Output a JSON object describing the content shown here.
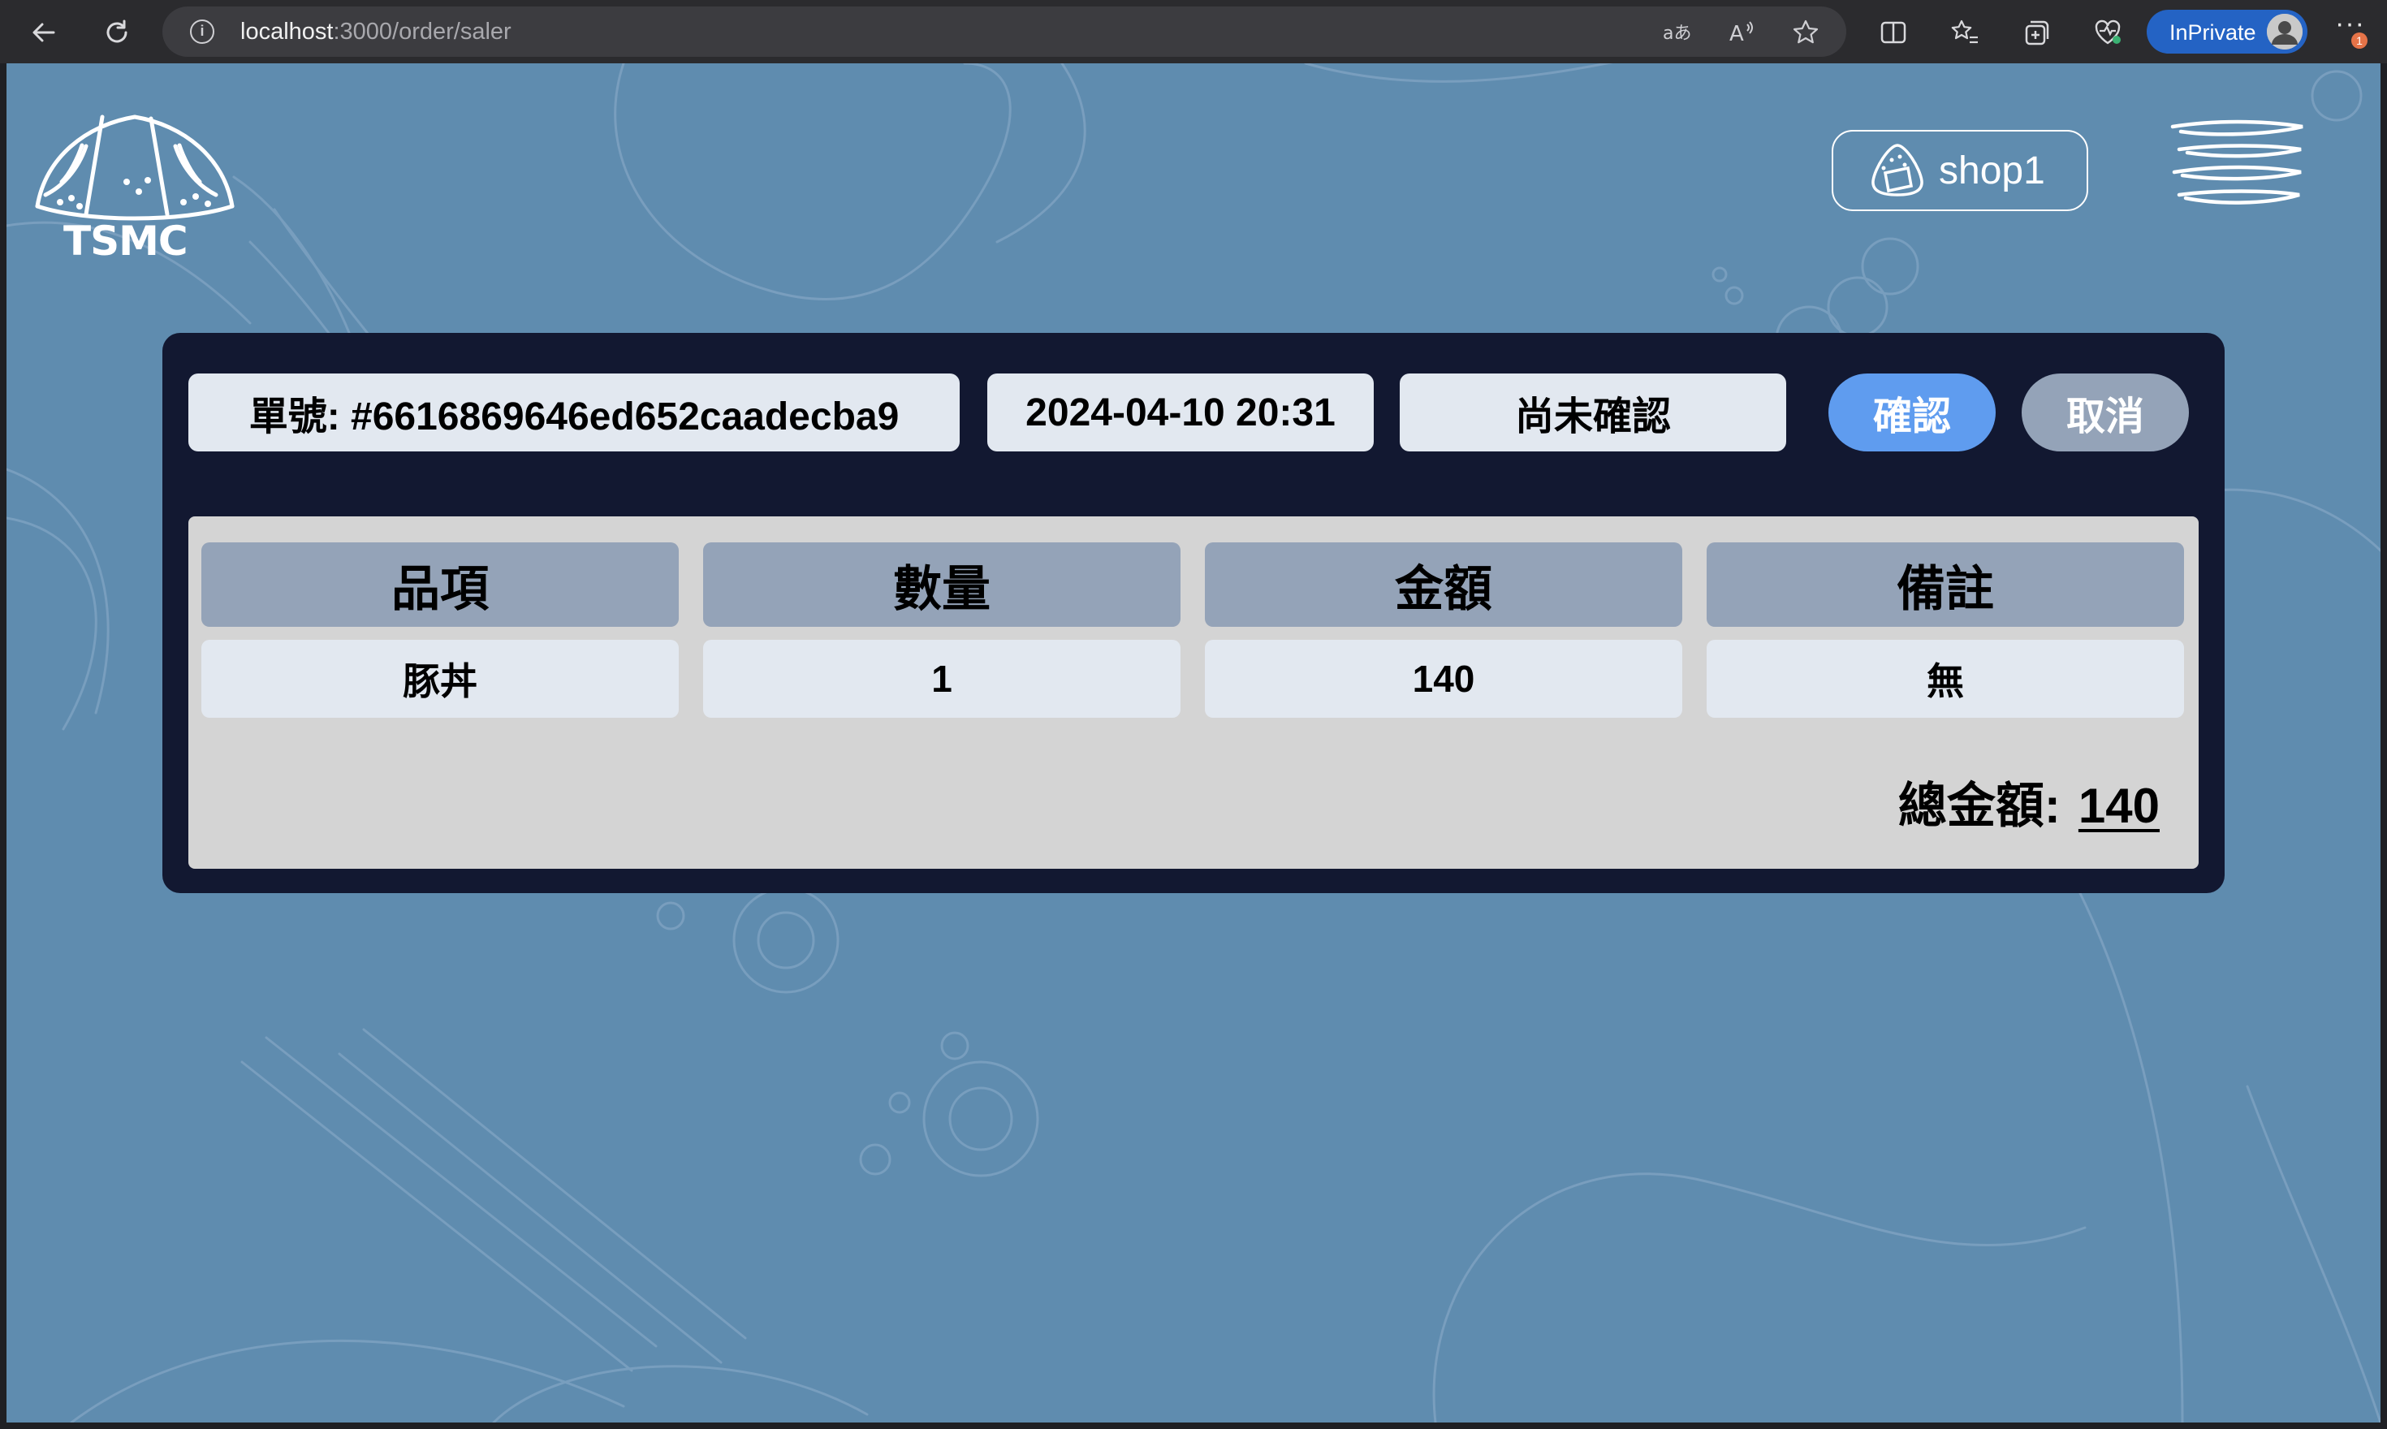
{
  "browser": {
    "url_host": "localhost",
    "url_path": ":3000/order/saler",
    "inprivate_label": "InPrivate",
    "notification_count": "1"
  },
  "header": {
    "brand": "TSMC",
    "shop_label": "shop1"
  },
  "order": {
    "id_label": "單號: #6616869646ed652caadecba9",
    "datetime": "2024-04-10 20:31",
    "status": "尚未確認",
    "confirm_label": "確認",
    "cancel_label": "取消"
  },
  "table": {
    "headers": [
      "品項",
      "數量",
      "金額",
      "備註"
    ],
    "rows": [
      [
        "豚丼",
        "1",
        "140",
        "無"
      ]
    ]
  },
  "summary": {
    "total_label": "總金額:",
    "total_value": "140"
  },
  "colors": {
    "page_bg": "#5f8caf",
    "card_bg": "#121831",
    "confirm": "#5f9cef",
    "cancel": "#94a3b8",
    "header_cell": "#94a3b8",
    "body_cell": "#e2e8f0"
  }
}
